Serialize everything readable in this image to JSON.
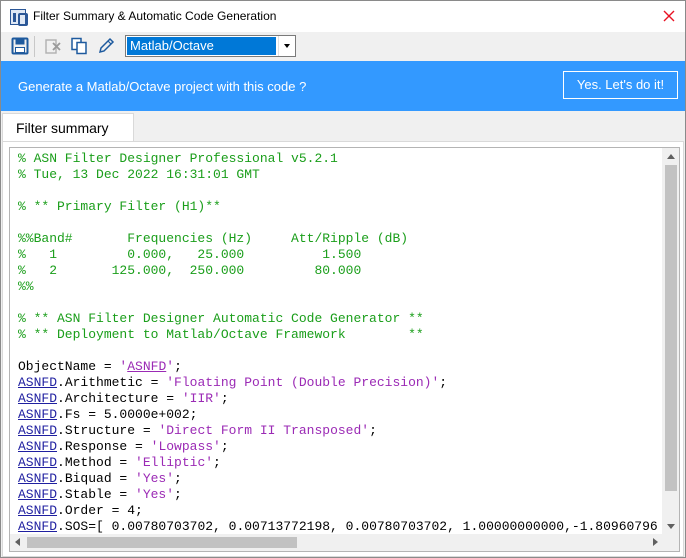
{
  "window": {
    "title": "Filter Summary & Automatic Code Generation"
  },
  "toolbar": {
    "icons": [
      "save-icon",
      "clear-icon",
      "copy-icon",
      "edit-icon"
    ],
    "language_selected": "Matlab/Octave"
  },
  "banner": {
    "text": "Generate a Matlab/Octave project with this code ?",
    "button_label": "Yes. Let's do it!"
  },
  "tabs": [
    {
      "label": "Filter summary"
    }
  ],
  "code_lines": [
    [
      {
        "t": "c",
        "v": "% ASN Filter Designer Professional v5.2.1"
      }
    ],
    [
      {
        "t": "c",
        "v": "% Tue, 13 Dec 2022 16:31:01 GMT"
      }
    ],
    [
      {
        "t": "c",
        "v": ""
      }
    ],
    [
      {
        "t": "c",
        "v": "% ** Primary Filter (H1)**"
      }
    ],
    [
      {
        "t": "c",
        "v": ""
      }
    ],
    [
      {
        "t": "c",
        "v": "%%Band#       Frequencies (Hz)     Att/Ripple (dB)"
      }
    ],
    [
      {
        "t": "c",
        "v": "%   1         0.000,   25.000          1.500"
      }
    ],
    [
      {
        "t": "c",
        "v": "%   2       125.000,  250.000         80.000"
      }
    ],
    [
      {
        "t": "c",
        "v": "%%"
      }
    ],
    [
      {
        "t": "c",
        "v": ""
      }
    ],
    [
      {
        "t": "c",
        "v": "% ** ASN Filter Designer Automatic Code Generator **"
      }
    ],
    [
      {
        "t": "c",
        "v": "% ** Deployment to Matlab/Octave Framework        **"
      }
    ],
    [
      {
        "t": "p",
        "v": ""
      }
    ],
    [
      {
        "t": "p",
        "v": "ObjectName = "
      },
      {
        "t": "s",
        "v": "'"
      },
      {
        "t": "sl",
        "v": "ASNFD"
      },
      {
        "t": "s",
        "v": "'"
      },
      {
        "t": "p",
        "v": ";"
      }
    ],
    [
      {
        "t": "l",
        "v": "ASNFD"
      },
      {
        "t": "p",
        "v": ".Arithmetic = "
      },
      {
        "t": "s",
        "v": "'Floating Point (Double Precision)'"
      },
      {
        "t": "p",
        "v": ";"
      }
    ],
    [
      {
        "t": "l",
        "v": "ASNFD"
      },
      {
        "t": "p",
        "v": ".Architecture = "
      },
      {
        "t": "s",
        "v": "'IIR'"
      },
      {
        "t": "p",
        "v": ";"
      }
    ],
    [
      {
        "t": "l",
        "v": "ASNFD"
      },
      {
        "t": "p",
        "v": ".Fs = 5.0000e+002;"
      }
    ],
    [
      {
        "t": "l",
        "v": "ASNFD"
      },
      {
        "t": "p",
        "v": ".Structure = "
      },
      {
        "t": "s",
        "v": "'Direct Form II Transposed'"
      },
      {
        "t": "p",
        "v": ";"
      }
    ],
    [
      {
        "t": "l",
        "v": "ASNFD"
      },
      {
        "t": "p",
        "v": ".Response = "
      },
      {
        "t": "s",
        "v": "'Lowpass'"
      },
      {
        "t": "p",
        "v": ";"
      }
    ],
    [
      {
        "t": "l",
        "v": "ASNFD"
      },
      {
        "t": "p",
        "v": ".Method = "
      },
      {
        "t": "s",
        "v": "'Elliptic'"
      },
      {
        "t": "p",
        "v": ";"
      }
    ],
    [
      {
        "t": "l",
        "v": "ASNFD"
      },
      {
        "t": "p",
        "v": ".Biquad = "
      },
      {
        "t": "s",
        "v": "'Yes'"
      },
      {
        "t": "p",
        "v": ";"
      }
    ],
    [
      {
        "t": "l",
        "v": "ASNFD"
      },
      {
        "t": "p",
        "v": ".Stable = "
      },
      {
        "t": "s",
        "v": "'Yes'"
      },
      {
        "t": "p",
        "v": ";"
      }
    ],
    [
      {
        "t": "l",
        "v": "ASNFD"
      },
      {
        "t": "p",
        "v": ".Order = 4;"
      }
    ],
    [
      {
        "t": "l",
        "v": "ASNFD"
      },
      {
        "t": "p",
        "v": ".SOS=[ 0.00780703702, 0.00713772198, 0.00780703702, 1.00000000000,-1.80960796"
      }
    ]
  ],
  "colors": {
    "banner": "#3399ff",
    "comment": "#1a9e1a",
    "string": "#9b2ab5",
    "link": "#1f1fa0",
    "selection": "#0078d7",
    "close_hover": "#e81123"
  }
}
